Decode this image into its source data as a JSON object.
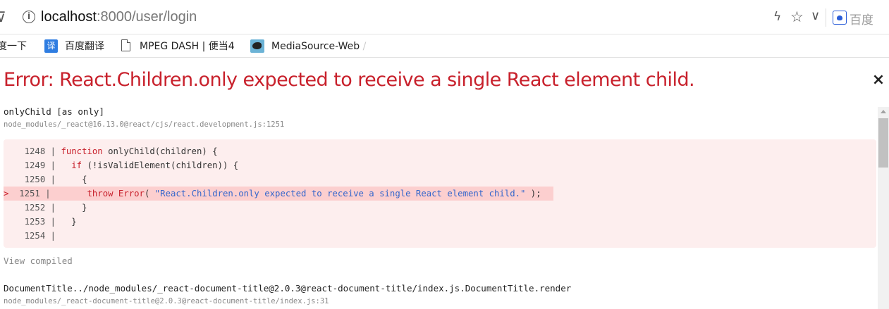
{
  "browser": {
    "url_host": "localhost",
    "url_path": ":8000/user/login",
    "search_engine": "百度",
    "icons": [
      "info-icon",
      "bolt-icon",
      "star-icon",
      "chevron-down-icon",
      "baidu-paw-icon"
    ]
  },
  "bookmarks": [
    {
      "label": "度一下",
      "icon": "none"
    },
    {
      "label": "百度翻译",
      "icon": "translate-icon"
    },
    {
      "label": "MPEG DASH | 便当4",
      "icon": "document-icon"
    },
    {
      "label": "MediaSource-Web",
      "icon": "bird-icon"
    }
  ],
  "error": {
    "title": "Error: React.Children.only expected to receive a single React element child.",
    "close_symbol": "×",
    "frames": [
      {
        "function": "onlyChild [as only]",
        "file": "node_modules/_react@16.13.0@react/cjs/react.development.js:1251",
        "code": [
          {
            "num": "1248",
            "text": "function onlyChild(children) {"
          },
          {
            "num": "1249",
            "text": "  if (!isValidElement(children)) {"
          },
          {
            "num": "1250",
            "text": "    {"
          },
          {
            "num": "1251",
            "text": "      throw Error( \"React.Children.only expected to receive a single React element child.\" );",
            "highlighted": true
          },
          {
            "num": "1252",
            "text": "    }"
          },
          {
            "num": "1253",
            "text": "  }"
          },
          {
            "num": "1254",
            "text": ""
          }
        ]
      },
      {
        "function": "DocumentTitle../node_modules/_react-document-title@2.0.3@react-document-title/index.js.DocumentTitle.render",
        "file": "node_modules/_react-document-title@2.0.3@react-document-title/index.js:31"
      }
    ],
    "view_compiled": "View compiled"
  },
  "colors": {
    "error_red": "#c8212c",
    "code_bg": "#fdeeee",
    "highlight_bg": "#fccfcf",
    "string_blue": "#3366cc"
  }
}
